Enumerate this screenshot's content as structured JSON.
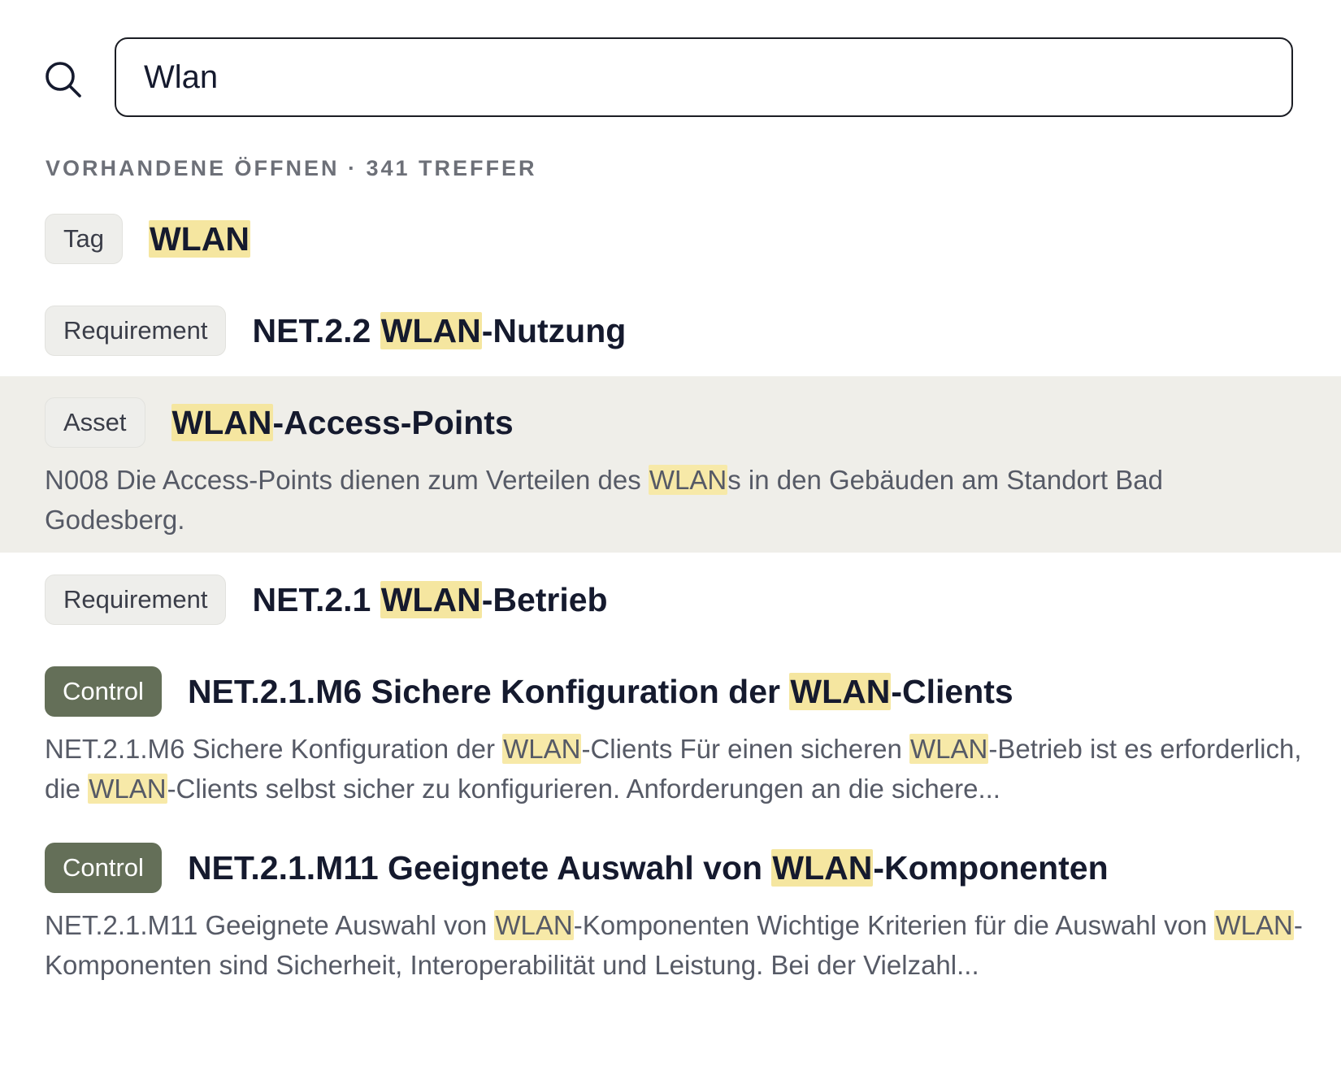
{
  "search": {
    "value": "Wlan",
    "placeholder": ""
  },
  "section_header": "VORHANDENE ÖFFNEN · 341 TREFFER",
  "highlight_term": "WLAN",
  "results": [
    {
      "badge": "Tag",
      "type": "tag",
      "title_parts": [
        {
          "t": "WLAN",
          "hl": true
        }
      ],
      "desc_parts": [],
      "highlighted": false
    },
    {
      "badge": "Requirement",
      "type": "requirement",
      "title_parts": [
        {
          "t": "NET.2.2 "
        },
        {
          "t": "WLAN",
          "hl": true
        },
        {
          "t": "-Nutzung"
        }
      ],
      "desc_parts": [],
      "highlighted": false
    },
    {
      "badge": "Asset",
      "type": "asset",
      "title_parts": [
        {
          "t": "WLAN",
          "hl": true
        },
        {
          "t": "-Access-Points"
        }
      ],
      "desc_parts": [
        {
          "t": "N008 Die Access-Points dienen zum Verteilen des "
        },
        {
          "t": "WLAN",
          "hl": true
        },
        {
          "t": "s in den Gebäuden am Standort Bad Godesberg."
        }
      ],
      "highlighted": true
    },
    {
      "badge": "Requirement",
      "type": "requirement",
      "title_parts": [
        {
          "t": "NET.2.1 "
        },
        {
          "t": "WLAN",
          "hl": true
        },
        {
          "t": "-Betrieb"
        }
      ],
      "desc_parts": [],
      "highlighted": false
    },
    {
      "badge": "Control",
      "type": "control",
      "title_parts": [
        {
          "t": "NET.2.1.M6 Sichere Konfiguration der "
        },
        {
          "t": "WLAN",
          "hl": true
        },
        {
          "t": "-Clients"
        }
      ],
      "desc_parts": [
        {
          "t": "NET.2.1.M6 Sichere Konfiguration der "
        },
        {
          "t": "WLAN",
          "hl": true
        },
        {
          "t": "-Clients Für einen sicheren "
        },
        {
          "t": "WLAN",
          "hl": true
        },
        {
          "t": "-Betrieb ist es erforderlich, die "
        },
        {
          "t": "WLAN",
          "hl": true
        },
        {
          "t": "-Clients selbst sicher zu konfigurieren. Anforderungen an die sichere..."
        }
      ],
      "highlighted": false
    },
    {
      "badge": "Control",
      "type": "control",
      "title_parts": [
        {
          "t": "NET.2.1.M11 Geeignete Auswahl von "
        },
        {
          "t": "WLAN",
          "hl": true
        },
        {
          "t": "-Komponenten"
        }
      ],
      "desc_parts": [
        {
          "t": "NET.2.1.M11 Geeignete Auswahl von "
        },
        {
          "t": "WLAN",
          "hl": true
        },
        {
          "t": "-Komponenten Wichtige Kriterien für die Auswahl von "
        },
        {
          "t": "WLAN",
          "hl": true
        },
        {
          "t": "-Komponenten sind Sicherheit, Interoperabilität und Leistung. Bei der Vielzahl..."
        }
      ],
      "highlighted": false
    }
  ],
  "colors": {
    "highlight": "#f7e9a8",
    "control_badge": "#646f58",
    "row_highlight": "#efeee9"
  }
}
